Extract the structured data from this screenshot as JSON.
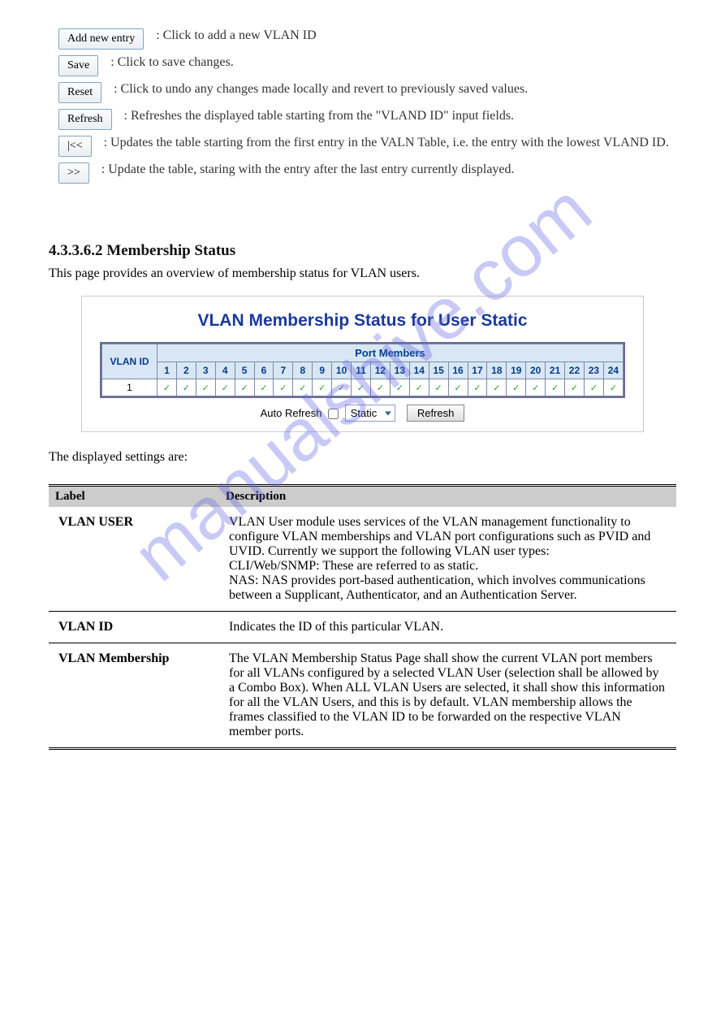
{
  "buttons_section": [
    {
      "label": "Add new entry",
      "desc": ": Click to add a new VLAN ID"
    },
    {
      "label": "Save",
      "desc": ": Click to save changes."
    },
    {
      "label": "Reset",
      "desc": ": Click to undo any changes made locally and revert to previously saved values."
    },
    {
      "label": "Refresh",
      "desc": ": Refreshes the displayed table starting from the \"VLAND ID\" input fields."
    },
    {
      "label": "|<<",
      "desc": ": Updates the table starting from the first entry in the VALN Table, i.e. the entry with the lowest VLAND ID."
    },
    {
      "label": ">>",
      "desc": ": Update the table, staring with the entry after the last entry currently displayed."
    }
  ],
  "heading": "4.3.3.6.2 Membership Status",
  "intro": "This page provides an overview of membership status for VLAN users.",
  "ui": {
    "title": "VLAN Membership Status for User Static",
    "header_vlanid": "VLAN ID",
    "header_portmembers": "Port Members",
    "ports": [
      "1",
      "2",
      "3",
      "4",
      "5",
      "6",
      "7",
      "8",
      "9",
      "10",
      "11",
      "12",
      "13",
      "14",
      "15",
      "16",
      "17",
      "18",
      "19",
      "20",
      "21",
      "22",
      "23",
      "24"
    ],
    "row_vid": "1",
    "auto_refresh_label": "Auto Refresh",
    "select_value": "Static",
    "refresh_btn": "Refresh"
  },
  "figure_caption": "The displayed settings are:",
  "param_header_label": "Label",
  "param_header_desc": "Description",
  "params": [
    {
      "label": "VLAN USER",
      "desc": "VLAN User module uses services of the VLAN management functionality to configure VLAN memberships and VLAN port configurations such as PVID and UVID. Currently we support the following VLAN user types:\nCLI/Web/SNMP: These are referred to as static.\nNAS: NAS provides port-based authentication, which involves communications between a Supplicant, Authenticator, and an Authentication Server."
    },
    {
      "label": "VLAN ID",
      "desc": "Indicates the ID of this particular VLAN."
    },
    {
      "label": "VLAN Membership",
      "desc": "The VLAN Membership Status Page shall show the current VLAN port members for all VLANs configured by a selected VLAN User (selection shall be allowed by a Combo Box). When ALL VLAN Users are selected, it shall show this information for all the VLAN Users, and this is by default. VLAN membership allows the frames classified to the VLAN ID to be forwarded on the respective VLAN member ports."
    }
  ]
}
